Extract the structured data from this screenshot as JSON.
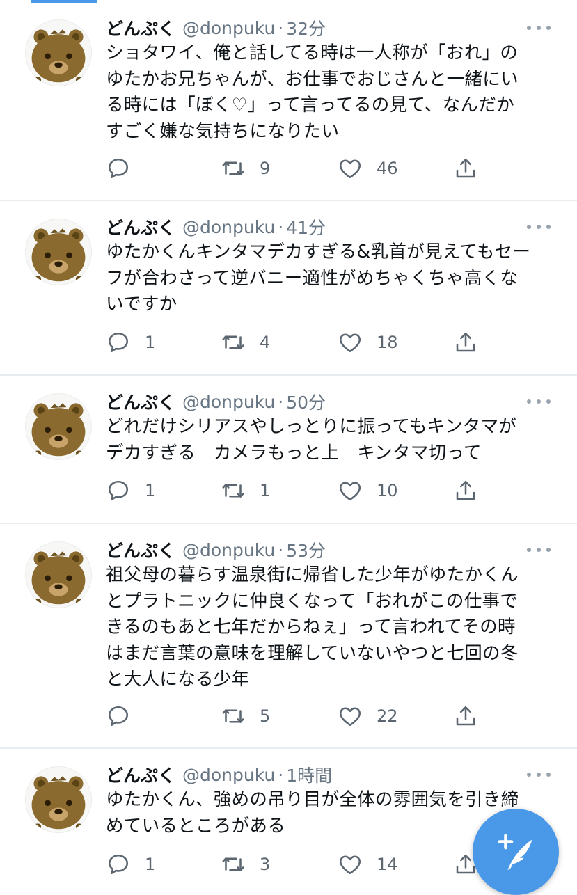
{
  "accent_color": "#4a99e9",
  "tweets": [
    {
      "name": "どんぷく",
      "handle": "@donpuku",
      "separator": "·",
      "time": "32分",
      "text": "ショタワイ、俺と話してる時は一人称が「おれ」の\nゆたかお兄ちゃんが、お仕事でおじさんと一緒にい\nる時には「ぼく♡」って言ってるの見て、なんだか\nすごく嫌な気持ちになりたい",
      "reply_count": "",
      "retweet_count": "9",
      "like_count": "46"
    },
    {
      "name": "どんぷく",
      "handle": "@donpuku",
      "separator": "·",
      "time": "41分",
      "text": "ゆたかくんキンタマデカすぎる&乳首が見えてもセー\nフが合わさって逆バニー適性がめちゃくちゃ高くな\nいですか",
      "reply_count": "1",
      "retweet_count": "4",
      "like_count": "18"
    },
    {
      "name": "どんぷく",
      "handle": "@donpuku",
      "separator": "·",
      "time": "50分",
      "text": "どれだけシリアスやしっとりに振ってもキンタマが\nデカすぎる　カメラもっと上　キンタマ切って",
      "reply_count": "1",
      "retweet_count": "1",
      "like_count": "10"
    },
    {
      "name": "どんぷく",
      "handle": "@donpuku",
      "separator": "·",
      "time": "53分",
      "text": "祖父母の暮らす温泉街に帰省した少年がゆたかくん\nとプラトニックに仲良くなって「おれがこの仕事で\nきるのもあと七年だからねぇ」って言われてその時\nはまだ言葉の意味を理解していないやつと七回の冬\nと大人になる少年",
      "reply_count": "",
      "retweet_count": "5",
      "like_count": "22"
    },
    {
      "name": "どんぷく",
      "handle": "@donpuku",
      "separator": "·",
      "time": "1時間",
      "text": "ゆたかくん、強めの吊り目が全体の雰囲気を引き締\nめているところがある",
      "reply_count": "1",
      "retweet_count": "3",
      "like_count": "14"
    }
  ],
  "icons": {
    "avatar": "bear-avatar",
    "reply": "speech-bubble-icon",
    "retweet": "retweet-icon",
    "like": "heart-outline-icon",
    "share": "share-upload-icon",
    "more": "ellipsis-icon",
    "compose": "feather-plus-icon"
  }
}
